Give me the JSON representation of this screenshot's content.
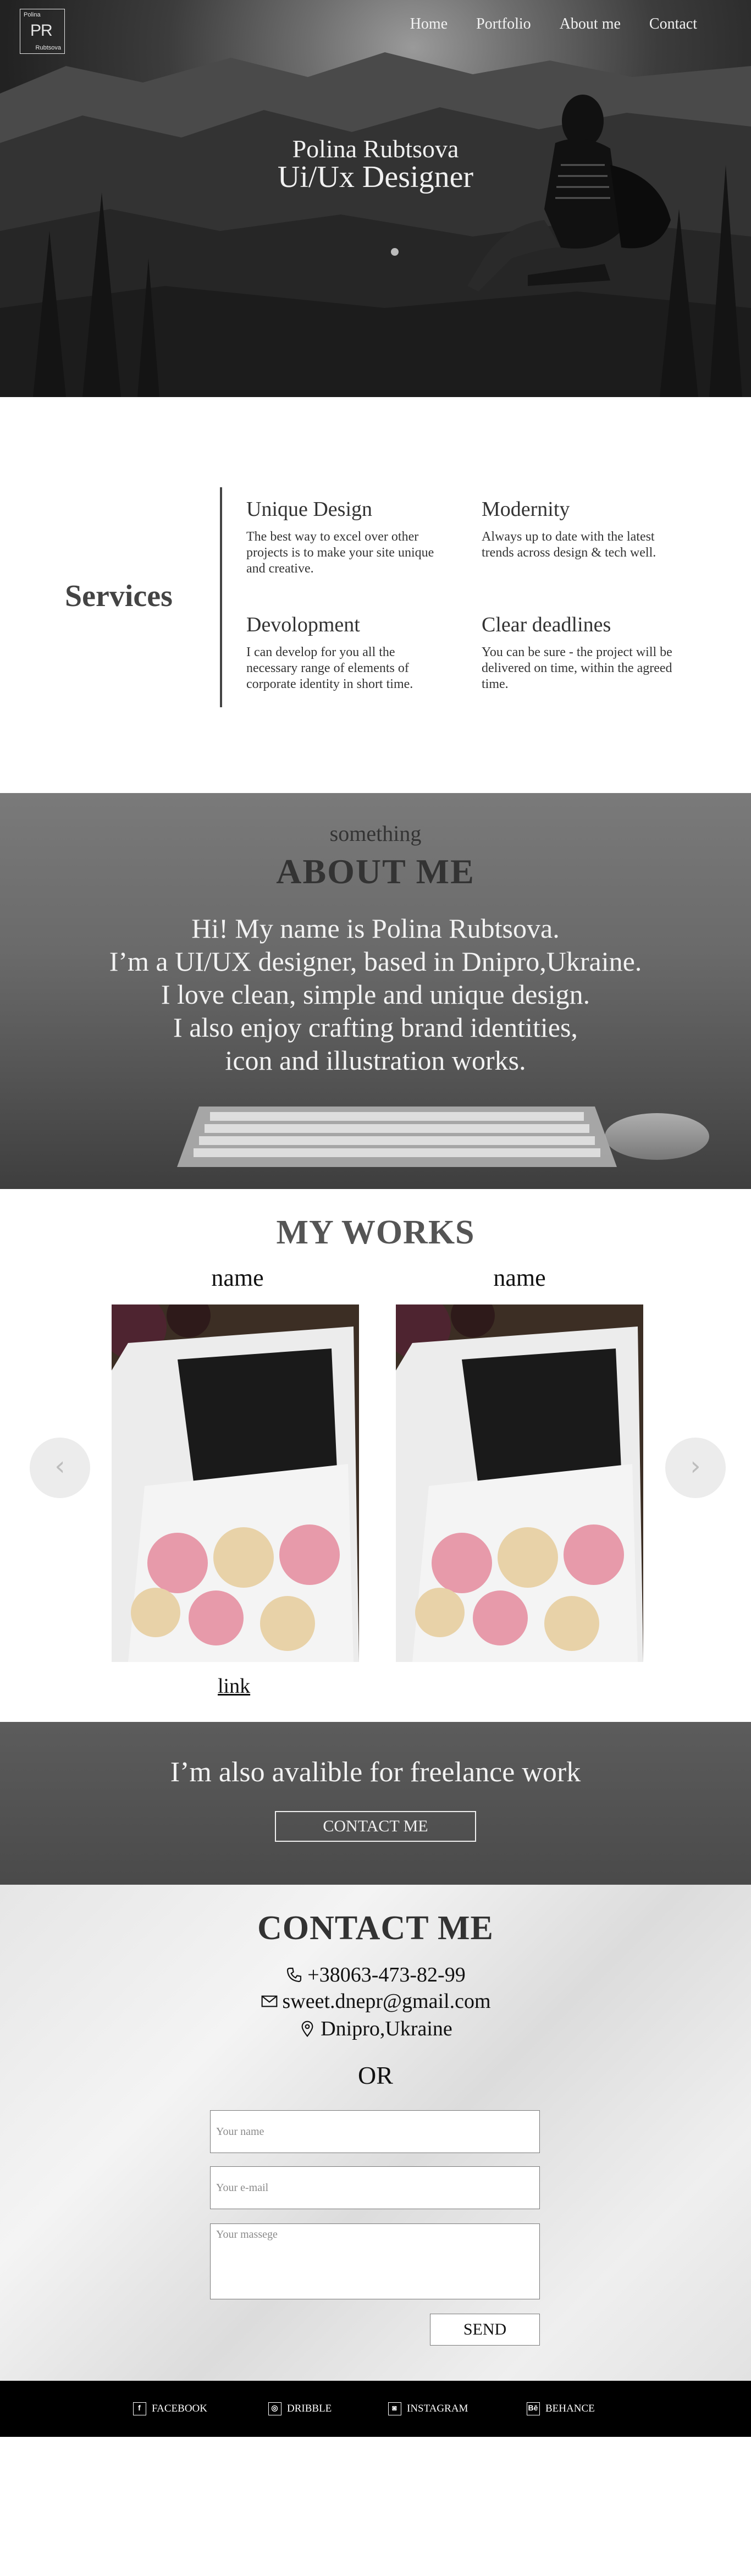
{
  "logo": {
    "top": "Polina",
    "initials": "PR",
    "bottom": "Rubtsova"
  },
  "nav": {
    "items": [
      "Home",
      "Portfolio",
      "About me",
      "Contact"
    ]
  },
  "hero": {
    "name": "Polina Rubtsova",
    "role": "Ui/Ux Designer"
  },
  "services": {
    "title": "Services",
    "items": [
      {
        "title": "Unique Design",
        "text": "The best way to excel over other projects is to make your site unique and creative."
      },
      {
        "title": "Modernity",
        "text": "Always up to date with the latest trends across design & tech well."
      },
      {
        "title": "Devolopment",
        "text": "I can develop for you all the necessary range of  elements of corporate identity in short time."
      },
      {
        "title": "Clear deadlines",
        "text": "You can be sure - the project will be delivered on time, within the agreed time."
      }
    ]
  },
  "about": {
    "subtitle": "something",
    "title": "ABOUT ME",
    "lines": [
      "Hi! My name is Polina Rubtsova.",
      "I’m a UI/UX designer, based in Dnipro,Ukraine.",
      "I love clean, simple and unique design.",
      "I also enjoy crafting brand identities,",
      "icon and illustration works."
    ]
  },
  "works": {
    "title": "MY WORKS",
    "items": [
      {
        "name": "name"
      },
      {
        "name": "name"
      }
    ],
    "link": "link",
    "prev_icon": "chevron-left-icon",
    "next_icon": "chevron-right-icon"
  },
  "freelance": {
    "text": "I’m also avalible for freelance work",
    "button": "CONTACT ME"
  },
  "contact": {
    "title": "CONTACT ME",
    "phone": "+38063-473-82-99",
    "email": "sweet.dnepr@gmail.com",
    "location": "Dnipro,Ukraine",
    "or": "OR",
    "name_placeholder": "Your name",
    "email_placeholder": "Your e-mail",
    "message_placeholder": "Your massege",
    "send": "SEND"
  },
  "footer": {
    "links": [
      {
        "label": "FACEBOOK",
        "icon": "facebook-icon",
        "glyph": "f"
      },
      {
        "label": "DRIBBLE",
        "icon": "dribbble-icon",
        "glyph": "◎"
      },
      {
        "label": "INSTAGRAM",
        "icon": "instagram-icon",
        "glyph": "◙"
      },
      {
        "label": "BEHANCE",
        "icon": "behance-icon",
        "glyph": "Bē"
      }
    ]
  }
}
